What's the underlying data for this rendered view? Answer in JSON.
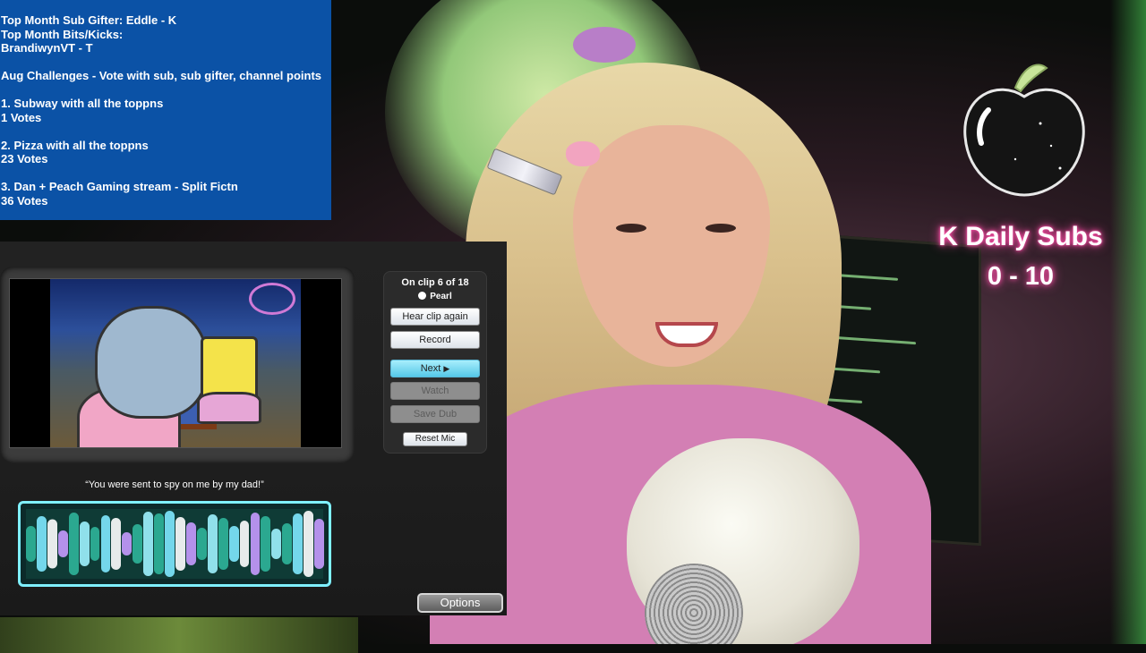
{
  "info_panel": {
    "lines": [
      "Top Month Sub Gifter:  Eddle - K",
      "Top Month Bits/Kicks:",
      "BrandiwynVT - T",
      "",
      "Aug Challenges - Vote with sub, sub gifter, channel points",
      "",
      "1. Subway with all the toppns",
      "1 Votes",
      "",
      "2. Pizza with all the toppns",
      "23 Votes",
      "",
      "3. Dan + Peach Gaming stream - Split Fictn",
      "36 Votes"
    ]
  },
  "subs_widget": {
    "title": "K Daily Subs",
    "count": "0 - 10",
    "icon": "peach-icon"
  },
  "game": {
    "clip_status": "On clip 6 of 18",
    "character": "Pearl",
    "buttons": {
      "hear_again": "Hear clip again",
      "record": "Record",
      "next": "Next",
      "watch": "Watch",
      "save_dub": "Save Dub",
      "reset_mic": "Reset Mic"
    },
    "quote": "“You were sent to spy on me by my dad!”",
    "options": "Options"
  },
  "colors": {
    "info_bg": "#0b52a6",
    "subs_glow": "#ff4fa8",
    "active_button": "#56c8e8",
    "waveform_border": "#7ff0ff"
  }
}
